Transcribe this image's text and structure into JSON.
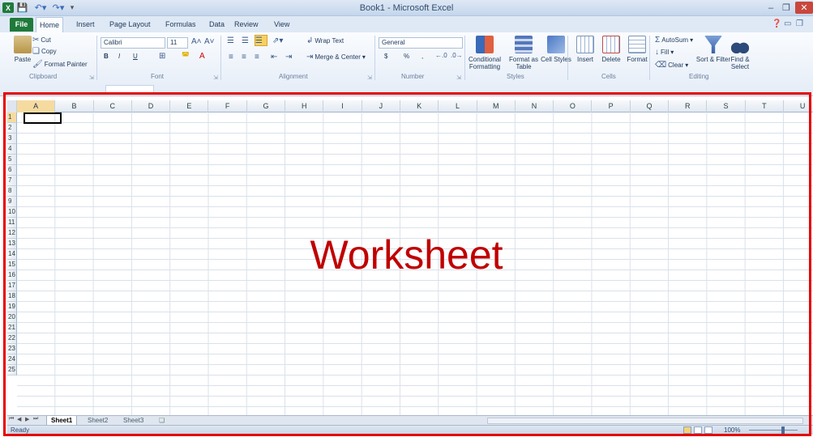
{
  "titlebar": {
    "app_icon_text": "X",
    "title": "Book1 - Microsoft Excel"
  },
  "tabs": {
    "file": "File",
    "home": "Home",
    "insert": "Insert",
    "page_layout": "Page Layout",
    "formulas": "Formulas",
    "data": "Data",
    "review": "Review",
    "view": "View"
  },
  "clipboard": {
    "label": "Clipboard",
    "paste": "Paste",
    "cut": "Cut",
    "copy": "Copy",
    "format_painter": "Format Painter"
  },
  "font": {
    "label": "Font",
    "name": "Calibri",
    "size": "11",
    "bold": "B",
    "italic": "I",
    "underline": "U"
  },
  "alignment": {
    "label": "Alignment",
    "wrap_text": "Wrap Text",
    "merge_center": "Merge & Center"
  },
  "number": {
    "label": "Number",
    "format": "General",
    "currency": "$",
    "percent": "%",
    "comma": ","
  },
  "styles": {
    "label": "Styles",
    "conditional": "Conditional Formatting",
    "format_table": "Format as Table",
    "cell_styles": "Cell Styles"
  },
  "cells": {
    "label": "Cells",
    "insert": "Insert",
    "delete": "Delete",
    "format": "Format"
  },
  "editing": {
    "label": "Editing",
    "autosum": "AutoSum",
    "fill": "Fill",
    "clear": "Clear",
    "sort_filter": "Sort & Filter",
    "find_select": "Find & Select"
  },
  "grid": {
    "columns": [
      "A",
      "B",
      "C",
      "D",
      "E",
      "F",
      "G",
      "H",
      "I",
      "J",
      "K",
      "L",
      "M",
      "N",
      "O",
      "P",
      "Q",
      "R",
      "S",
      "T",
      "U"
    ],
    "rows": [
      "1",
      "2",
      "3",
      "4",
      "5",
      "6",
      "7",
      "8",
      "9",
      "10",
      "11",
      "12",
      "13",
      "14",
      "15",
      "16",
      "17",
      "18",
      "19",
      "20",
      "21",
      "22",
      "23",
      "24",
      "25"
    ]
  },
  "sheets": [
    "Sheet1",
    "Sheet2",
    "Sheet3"
  ],
  "status": {
    "ready": "Ready",
    "zoom": "100%"
  },
  "annotation": {
    "label": "Worksheet",
    "color": "#c00000",
    "frame_color": "#e50000"
  },
  "colors": {
    "file_tab": "#1f7a3a",
    "close": "#c9463d",
    "ribbon_bg": "#e4ecf7"
  }
}
